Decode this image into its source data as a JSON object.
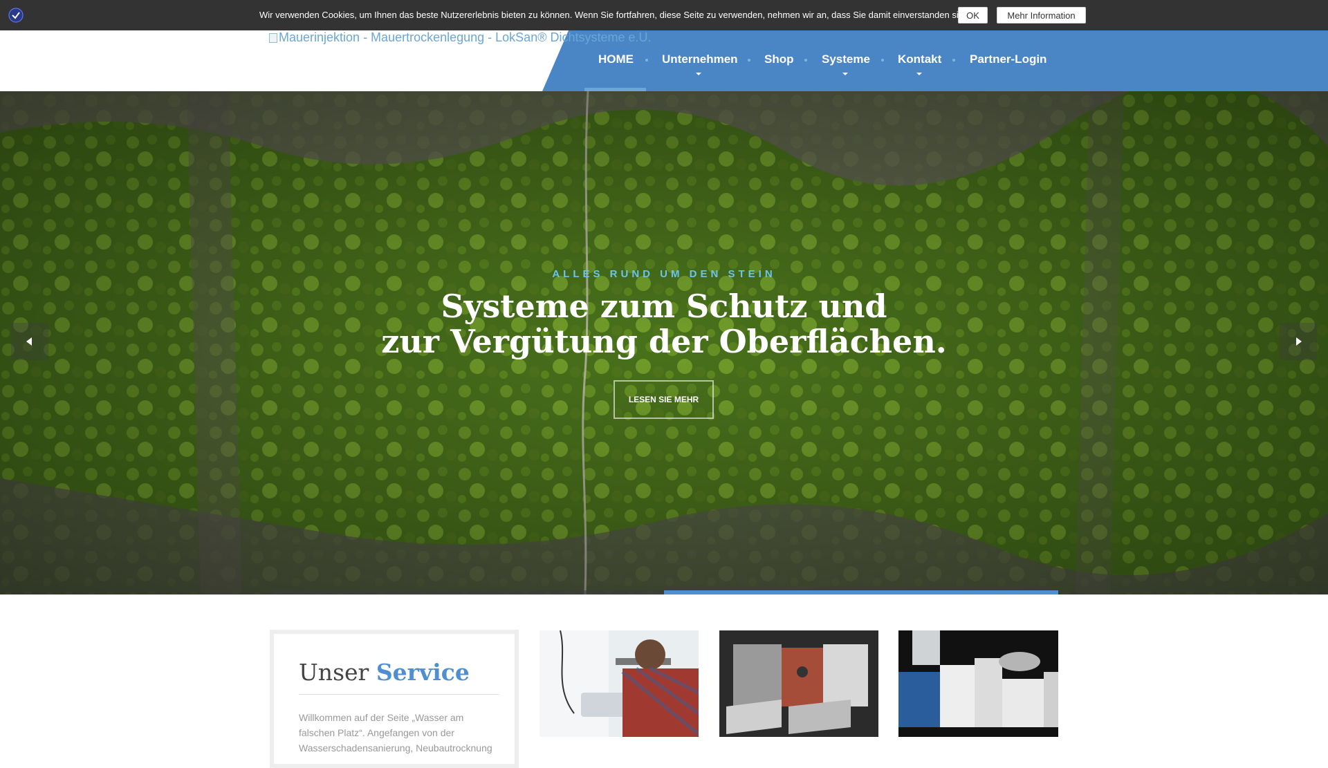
{
  "cookie_bar": {
    "text": "Wir verwenden Cookies, um Ihnen das beste Nutzererlebnis bieten zu können. Wenn Sie fortfahren, diese Seite zu verwenden, nehmen wir an, dass Sie damit einverstanden sind.",
    "ok_label": "OK",
    "more_label": "Mehr Information",
    "icon": "shield-check-icon"
  },
  "header": {
    "logo_alt": "Mauerinjektion - Mauertrockenlegung - LokSan® Dichtsysteme e.U.",
    "nav": [
      {
        "label": "HOME",
        "active": true,
        "dropdown": false
      },
      {
        "label": "Unternehmen",
        "active": false,
        "dropdown": true
      },
      {
        "label": "Shop",
        "active": false,
        "dropdown": false
      },
      {
        "label": "Systeme",
        "active": false,
        "dropdown": true
      },
      {
        "label": "Kontakt",
        "active": false,
        "dropdown": true
      },
      {
        "label": "Partner-Login",
        "active": false,
        "dropdown": false
      }
    ]
  },
  "hero": {
    "kicker": "ALLES RUND UM DEN STEIN",
    "title_line1": "Systeme zum Schutz und",
    "title_line2": "zur Vergütung der Oberflächen.",
    "button_label": "LESEN SIE MEHR",
    "prev_icon": "arrow-left-icon",
    "next_icon": "arrow-right-icon",
    "slide_progress": 1.0
  },
  "service": {
    "title_plain": "Unser",
    "title_accent": "Service",
    "text": "Willkommen auf der Seite „Wasser am falschen Platz“. Angefangen von der Wasserschadensanierung, Neubautrocknung"
  },
  "colors": {
    "accent_blue": "#4f8fd1",
    "nav_blue": "#4a86c5",
    "cookie_bg": "#333333",
    "kicker": "#6cc4ea"
  }
}
